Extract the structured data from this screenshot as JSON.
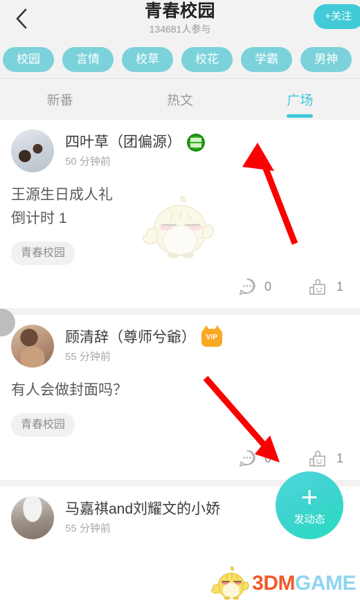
{
  "header": {
    "back_icon": "chevron-left-icon",
    "title": "青春校园",
    "subtitle": "134681人参与",
    "follow_label": "+关注",
    "accent_color": "#43cad8"
  },
  "tags": [
    {
      "label": "校园"
    },
    {
      "label": "言情"
    },
    {
      "label": "校草"
    },
    {
      "label": "校花"
    },
    {
      "label": "学霸"
    },
    {
      "label": "男神"
    }
  ],
  "tabs": [
    {
      "label": "新番",
      "active": false
    },
    {
      "label": "热文",
      "active": false
    },
    {
      "label": "广场",
      "active": true
    }
  ],
  "posts": [
    {
      "name": "四叶草（团偏源）",
      "badge": "verified-green-badge",
      "time": "50 分钟前",
      "body": "王源生日成人礼\n倒计时   1",
      "tag": "青春校园",
      "comment_count": "0",
      "like_count": "1"
    },
    {
      "name": "顾清辞（尊师兮爺）",
      "badge": "vip-badge",
      "badge_text": "VIP",
      "time": "55 分钟前",
      "body": "有人会做封面吗？",
      "tag": "青春校园",
      "comment_count": "0",
      "like_count": "1"
    },
    {
      "name": "马嘉祺and刘耀文的小娇",
      "time": "55 分钟前"
    }
  ],
  "fab": {
    "icon": "plus-icon",
    "label": "发动态"
  },
  "annotations": {
    "arrow_one_target": "广场",
    "arrow_two_target": "发动态",
    "arrow_color": "#fa0000"
  },
  "watermark": {
    "text_primary": "3DM",
    "text_secondary": "GAME",
    "icon": "chick-logo-icon"
  }
}
